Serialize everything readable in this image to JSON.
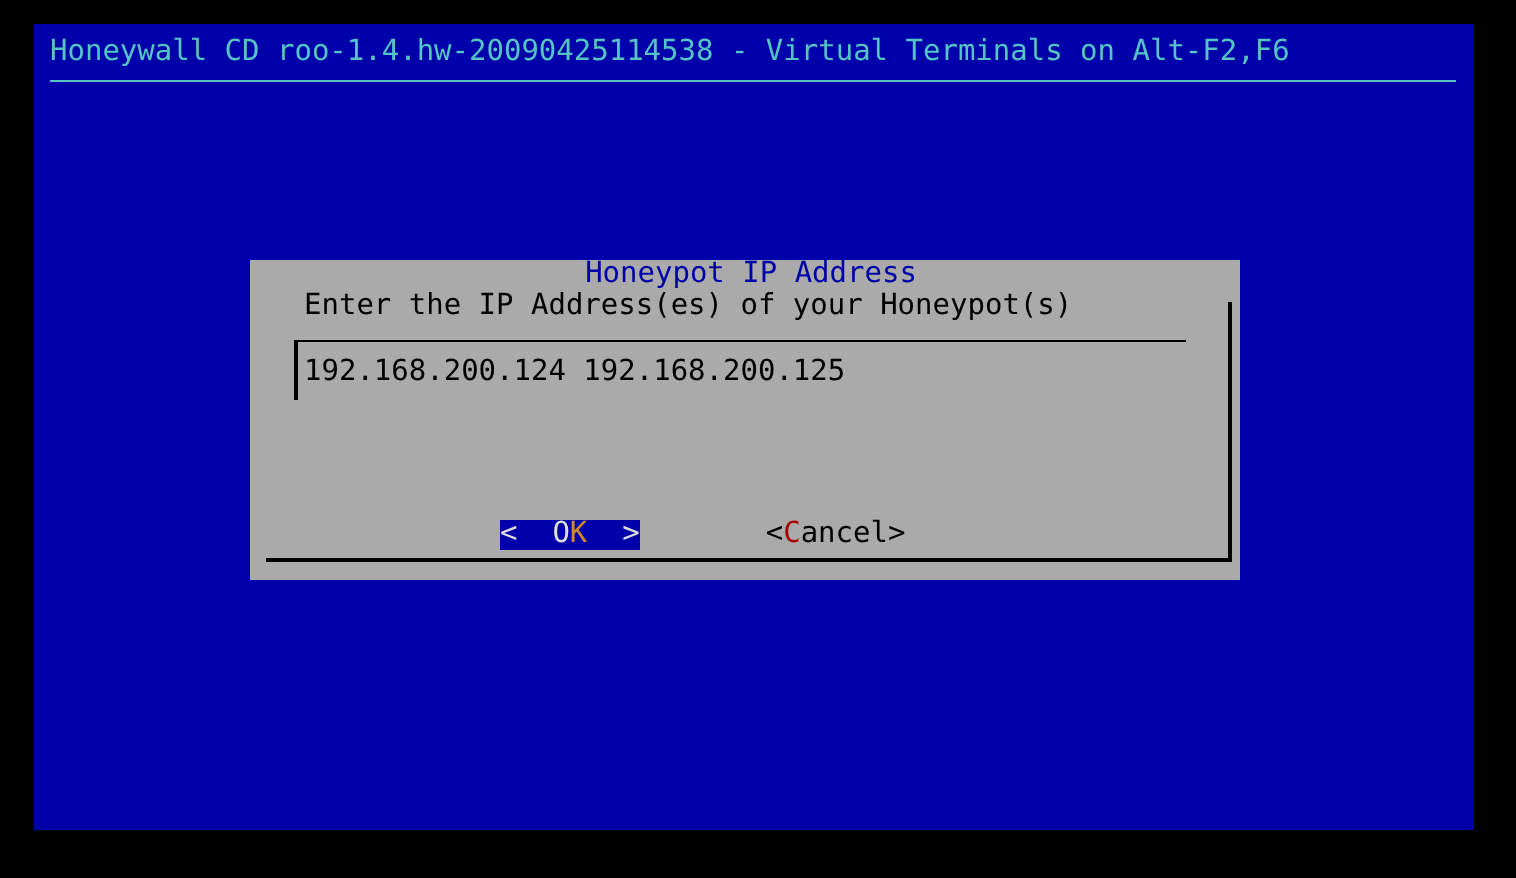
{
  "header": {
    "title": "Honeywall CD roo-1.4.hw-20090425114538 - Virtual Terminals on Alt-F2,F6"
  },
  "dialog": {
    "title": "Honeypot IP Address",
    "prompt": "Enter the IP Address(es) of your Honeypot(s)",
    "input": {
      "value": "192.168.200.124 192.168.200.125"
    },
    "buttons": [
      {
        "before": "<  O",
        "hotkey": "K",
        "after": "  >",
        "selected": true
      },
      {
        "before": "<",
        "hotkey": "C",
        "after": "ancel>",
        "selected": false
      }
    ]
  }
}
